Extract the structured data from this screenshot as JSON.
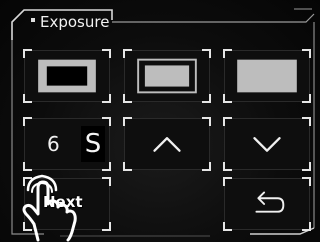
{
  "panel": {
    "title": "Exposure"
  },
  "buttons": {
    "exposure_large": {
      "icon": "large-rectangle-icon"
    },
    "exposure_medium": {
      "icon": "medium-rectangle-icon"
    },
    "exposure_full": {
      "icon": "full-rectangle-icon"
    },
    "time_value": "6",
    "time_unit": "S",
    "increase": {
      "icon": "chevron-up-icon"
    },
    "decrease": {
      "icon": "chevron-down-icon"
    },
    "next": "Next",
    "back": {
      "icon": "return-arrow-icon"
    }
  },
  "colors": {
    "background": "#0c0c0c",
    "frame": "#d8d8d8",
    "icon_fill": "#bdbdbd",
    "text": "#f0f0f0"
  }
}
